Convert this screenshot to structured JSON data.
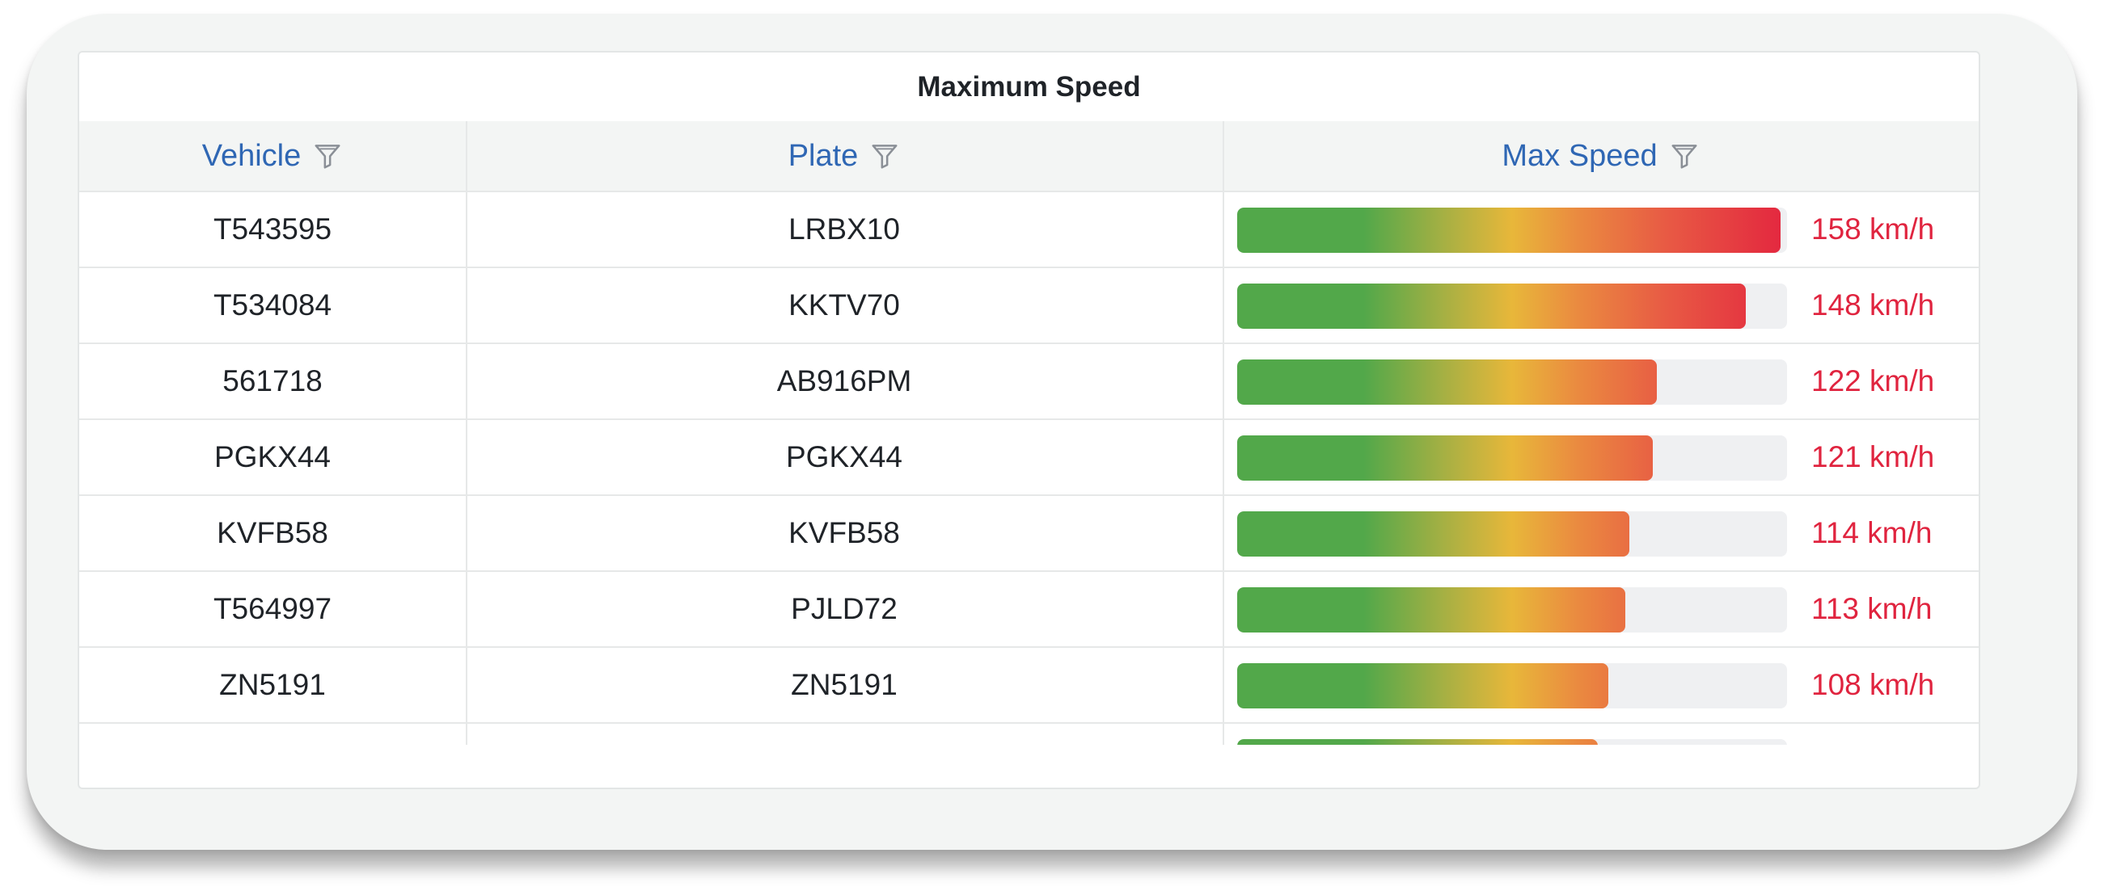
{
  "widget": {
    "title": "Maximum Speed"
  },
  "table": {
    "columns": [
      {
        "label": "Vehicle",
        "icon": "filter-icon"
      },
      {
        "label": "Plate",
        "icon": "filter-icon"
      },
      {
        "label": "Max Speed",
        "icon": "filter-icon"
      }
    ],
    "speed_scale_max": 160,
    "rows": [
      {
        "vehicle": "T543595",
        "plate": "LRBX10",
        "speed": 158,
        "speed_label": "158 km/h"
      },
      {
        "vehicle": "T534084",
        "plate": "KKTV70",
        "speed": 148,
        "speed_label": "148 km/h"
      },
      {
        "vehicle": "561718",
        "plate": "AB916PM",
        "speed": 122,
        "speed_label": "122 km/h"
      },
      {
        "vehicle": "PGKX44",
        "plate": "PGKX44",
        "speed": 121,
        "speed_label": "121 km/h"
      },
      {
        "vehicle": "KVFB58",
        "plate": "KVFB58",
        "speed": 114,
        "speed_label": "114 km/h"
      },
      {
        "vehicle": "T564997",
        "plate": "PJLD72",
        "speed": 113,
        "speed_label": "113 km/h"
      },
      {
        "vehicle": "ZN5191",
        "plate": "ZN5191",
        "speed": 108,
        "speed_label": "108 km/h"
      },
      {
        "vehicle": "",
        "plate": "",
        "speed": 105,
        "speed_label": ""
      }
    ]
  },
  "colors": {
    "header_text": "#2f67b4",
    "speed_text": "#e0243f",
    "bar_green": "#52a84a",
    "bar_yellow": "#e8b73a",
    "bar_red": "#e3263f",
    "bar_track": "#eff0f2"
  }
}
